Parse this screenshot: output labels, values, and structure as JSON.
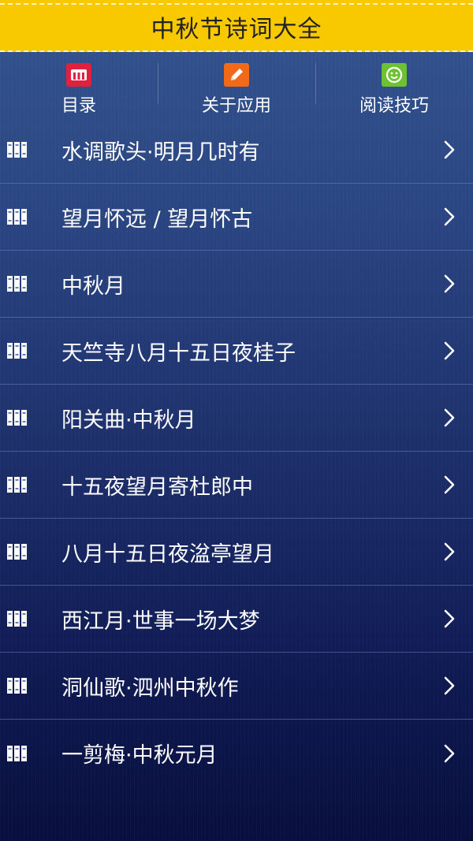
{
  "header": {
    "title": "中秋节诗词大全"
  },
  "toolbar": {
    "items": [
      {
        "label": "目录",
        "icon": "menu-m-icon",
        "color": "#e0203c"
      },
      {
        "label": "关于应用",
        "icon": "edit-pencil-icon",
        "color": "#f06a1a"
      },
      {
        "label": "阅读技巧",
        "icon": "smiley-icon",
        "color": "#6cc232"
      }
    ]
  },
  "poems": [
    {
      "title": "水调歌头·明月几时有"
    },
    {
      "title": "望月怀远 / 望月怀古"
    },
    {
      "title": "中秋月"
    },
    {
      "title": "天竺寺八月十五日夜桂子"
    },
    {
      "title": "阳关曲·中秋月"
    },
    {
      "title": "十五夜望月寄杜郎中"
    },
    {
      "title": "八月十五日夜湓亭望月"
    },
    {
      "title": "西江月·世事一场大梦"
    },
    {
      "title": "洞仙歌·泗州中秋作"
    },
    {
      "title": "一剪梅·中秋元月"
    }
  ],
  "colors": {
    "title_bar": "#f8c800",
    "background_top": "#34548f",
    "background_bottom": "#080f3d"
  }
}
